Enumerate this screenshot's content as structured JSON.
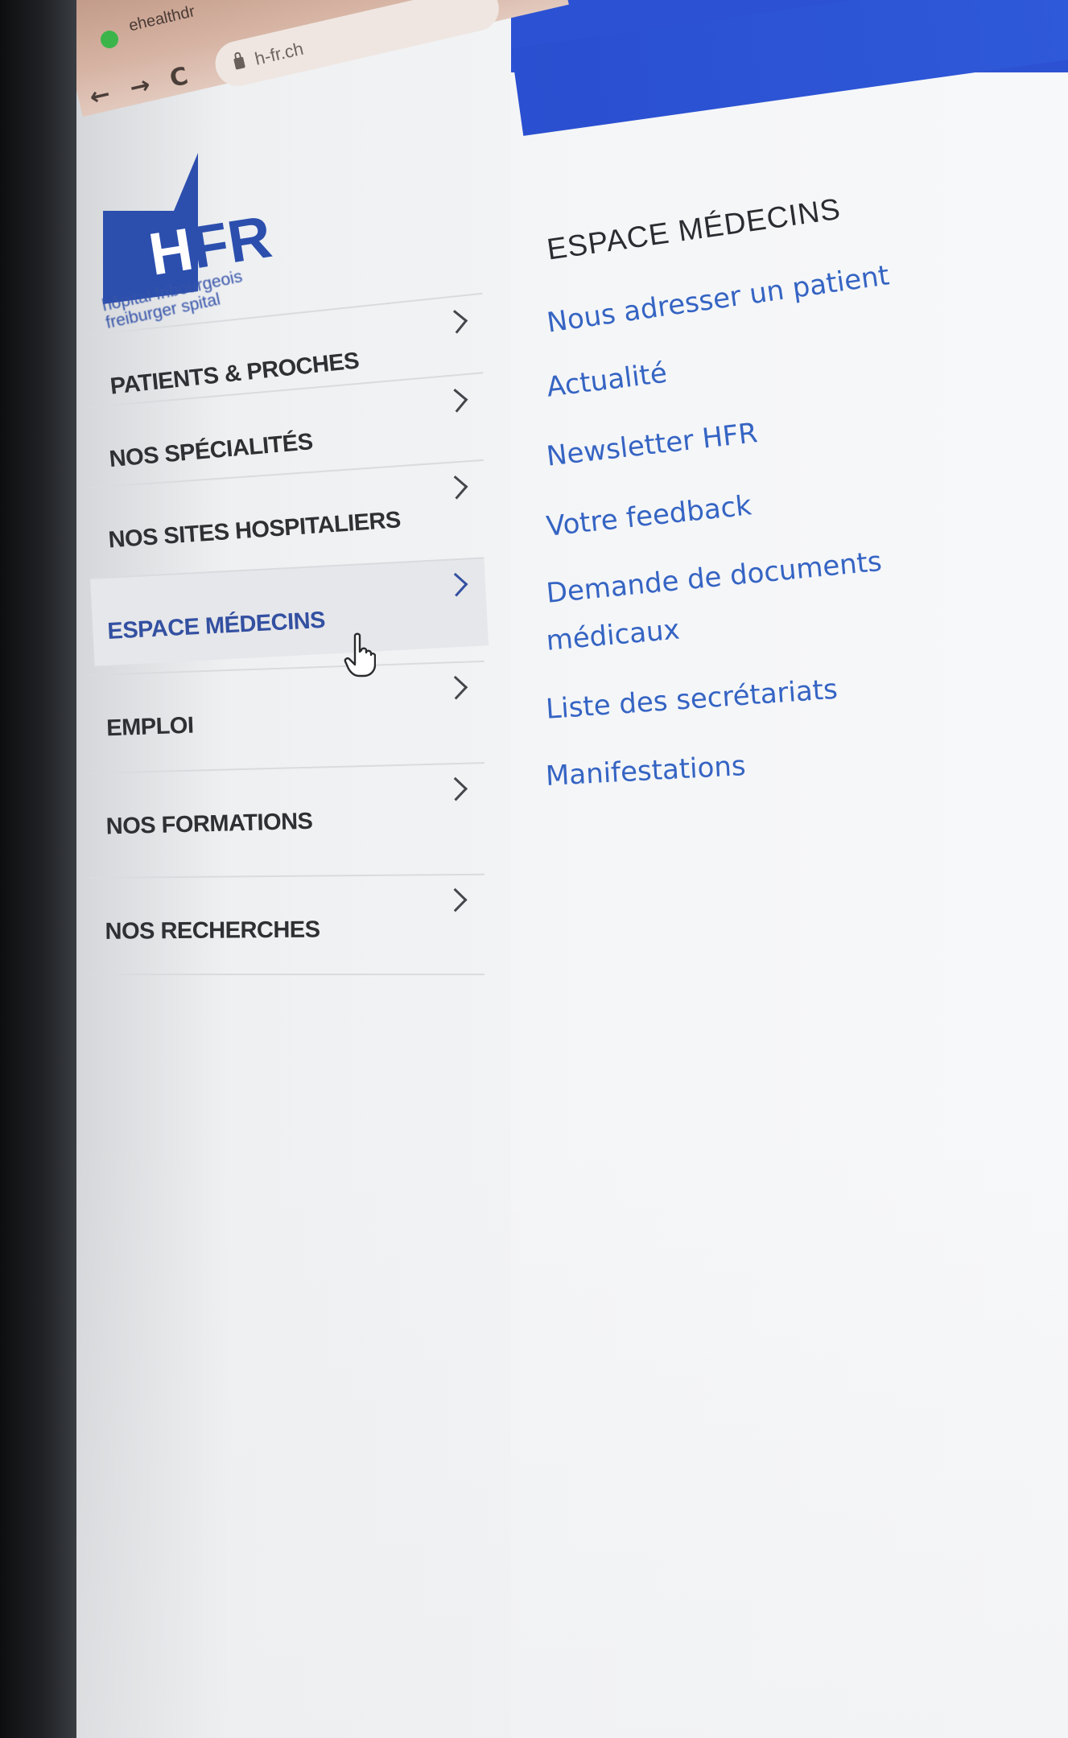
{
  "browser": {
    "tab_title": "ehealthdr",
    "url": "h-fr.ch",
    "back_glyph": "←",
    "forward_glyph": "→",
    "reload_glyph": "C"
  },
  "logo": {
    "brand": "HFR",
    "line1": "hôpital fribourgeois",
    "line2": "freiburger spital",
    "color": "#2c4fae"
  },
  "nav": {
    "items": [
      {
        "label": "PATIENTS & PROCHES",
        "active": false
      },
      {
        "label": "NOS SPÉCIALITÉS",
        "active": false
      },
      {
        "label": "NOS SITES HOSPITALIERS",
        "active": false
      },
      {
        "label": "ESPACE MÉDECINS",
        "active": true
      },
      {
        "label": "EMPLOI",
        "active": false
      },
      {
        "label": "NOS FORMATIONS",
        "active": false
      },
      {
        "label": "NOS RECHERCHES",
        "active": false
      }
    ]
  },
  "panel": {
    "heading": "ESPACE MÉDECINS",
    "links": [
      "Nous adresser un patient",
      "Actualité",
      "Newsletter HFR",
      "Votre feedback",
      "Demande de documents",
      "médicaux",
      "Liste des secrétariats",
      "Manifestations"
    ]
  },
  "colors": {
    "accent_blue": "#2c52d3",
    "link_blue": "#3564c3",
    "active_nav": "#3350a1"
  },
  "icons": {
    "chevron": "chevron-right-icon",
    "cursor": "hand-pointer-icon",
    "lock": "lock-icon"
  }
}
